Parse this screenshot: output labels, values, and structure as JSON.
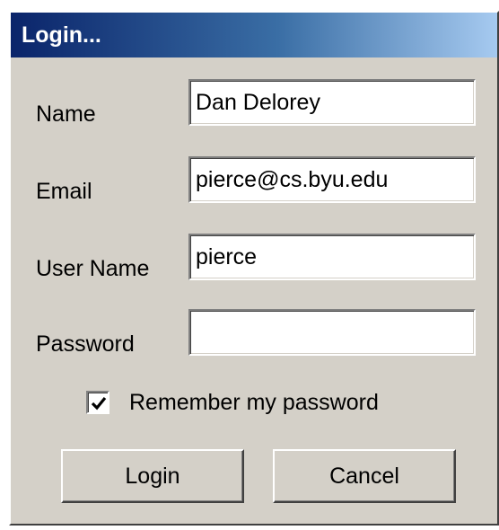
{
  "window": {
    "title": "Login..."
  },
  "form": {
    "name": {
      "label": "Name",
      "value": "Dan Delorey"
    },
    "email": {
      "label": "Email",
      "value": "pierce@cs.byu.edu"
    },
    "username": {
      "label": "User Name",
      "value": "pierce"
    },
    "password": {
      "label": "Password",
      "value": ""
    },
    "remember": {
      "label": "Remember my password",
      "checked": true
    }
  },
  "buttons": {
    "login_label": "Login",
    "cancel_label": "Cancel"
  },
  "colors": {
    "face": "#d4d0c8",
    "title_start": "#0a246a",
    "title_end": "#a6caf0"
  },
  "icons": {
    "checkmark": "checkmark-icon"
  }
}
